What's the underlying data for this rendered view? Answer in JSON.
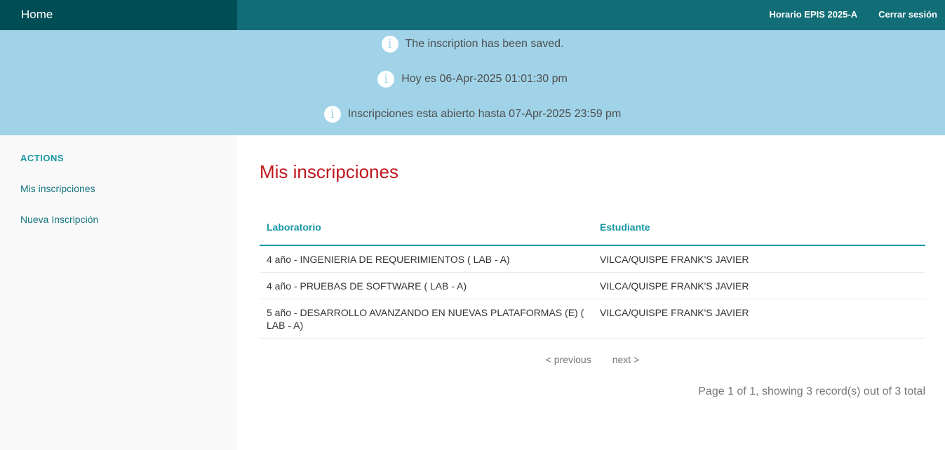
{
  "topbar": {
    "home_label": "Home",
    "schedule_link": "Horario EPIS 2025-A",
    "logout_link": "Cerrar sesión"
  },
  "flash": {
    "messages": [
      "The inscription has been saved.",
      "Hoy es 06-Apr-2025 01:01:30 pm",
      "Inscripciones esta abierto hasta 07-Apr-2025 23:59 pm"
    ],
    "icon": "info-icon",
    "icon_glyph": "i"
  },
  "sidebar": {
    "heading": "ACTIONS",
    "items": [
      {
        "label": "Mis inscripciones"
      },
      {
        "label": "Nueva Inscripción"
      }
    ]
  },
  "main": {
    "title": "Mis inscripciones",
    "table": {
      "headers": [
        "Laboratorio",
        "Estudiante"
      ],
      "rows": [
        [
          "4 año - INGENIERIA DE REQUERIMIENTOS ( LAB - A)",
          "VILCA/QUISPE FRANK'S JAVIER"
        ],
        [
          "4 año - PRUEBAS DE SOFTWARE ( LAB - A)",
          "VILCA/QUISPE FRANK'S JAVIER"
        ],
        [
          "5 año - DESARROLLO AVANZANDO EN NUEVAS PLATAFORMAS (E) ( LAB - A)",
          "VILCA/QUISPE FRANK'S JAVIER"
        ]
      ]
    },
    "paginator": {
      "previous": "< previous",
      "next": "next >"
    },
    "counter": "Page 1 of 1, showing 3 record(s) out of 3 total"
  },
  "colors": {
    "topbar": "#116d76",
    "brand": "#004e55",
    "flash_bg": "#a0d3e8",
    "accent": "#1798a5",
    "title": "#c0171d"
  }
}
